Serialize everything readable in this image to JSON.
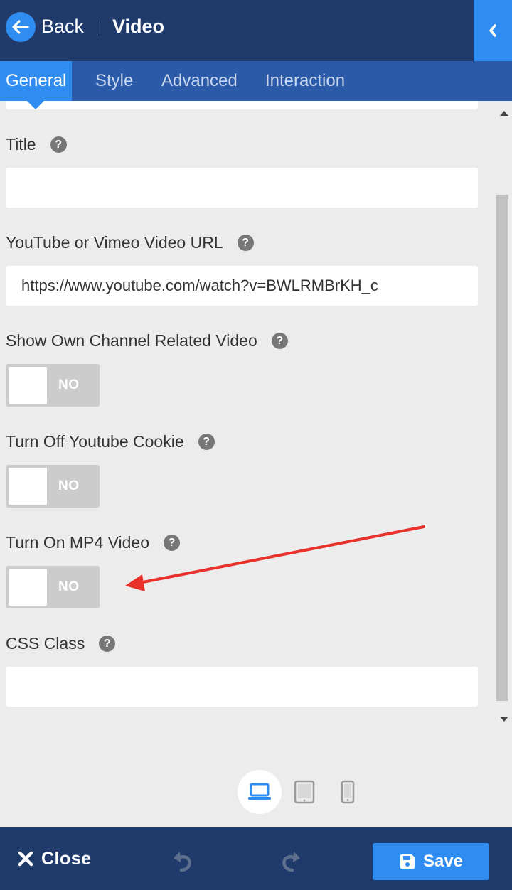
{
  "header": {
    "back_label": "Back",
    "title": "Video"
  },
  "tabs": [
    {
      "label": "General",
      "active": true
    },
    {
      "label": "Style",
      "active": false
    },
    {
      "label": "Advanced",
      "active": false
    },
    {
      "label": "Interaction",
      "active": false
    }
  ],
  "fields": {
    "title": {
      "label": "Title",
      "value": ""
    },
    "video_url": {
      "label": "YouTube or Vimeo Video URL",
      "value": "https://www.youtube.com/watch?v=BWLRMBrKH_c"
    },
    "own_channel_related": {
      "label": "Show Own Channel Related Video",
      "state": "NO"
    },
    "youtube_cookie": {
      "label": "Turn Off Youtube Cookie",
      "state": "NO"
    },
    "mp4_video": {
      "label": "Turn On MP4 Video",
      "state": "NO"
    },
    "css_class": {
      "label": "CSS Class",
      "value": ""
    }
  },
  "devices": {
    "active": "desktop",
    "options": [
      "desktop",
      "tablet",
      "mobile"
    ]
  },
  "footer": {
    "close_label": "Close",
    "save_label": "Save"
  },
  "colors": {
    "header_bg": "#1f3a6b",
    "tab_bar_bg": "#2a5aa8",
    "accent": "#2f8cf0",
    "annotation_arrow": "#e8312a"
  },
  "icons": [
    "back-arrow-icon",
    "chevron-left-icon",
    "help-icon",
    "desktop-icon",
    "tablet-icon",
    "mobile-icon",
    "close-icon",
    "undo-icon",
    "redo-icon",
    "save-icon"
  ]
}
